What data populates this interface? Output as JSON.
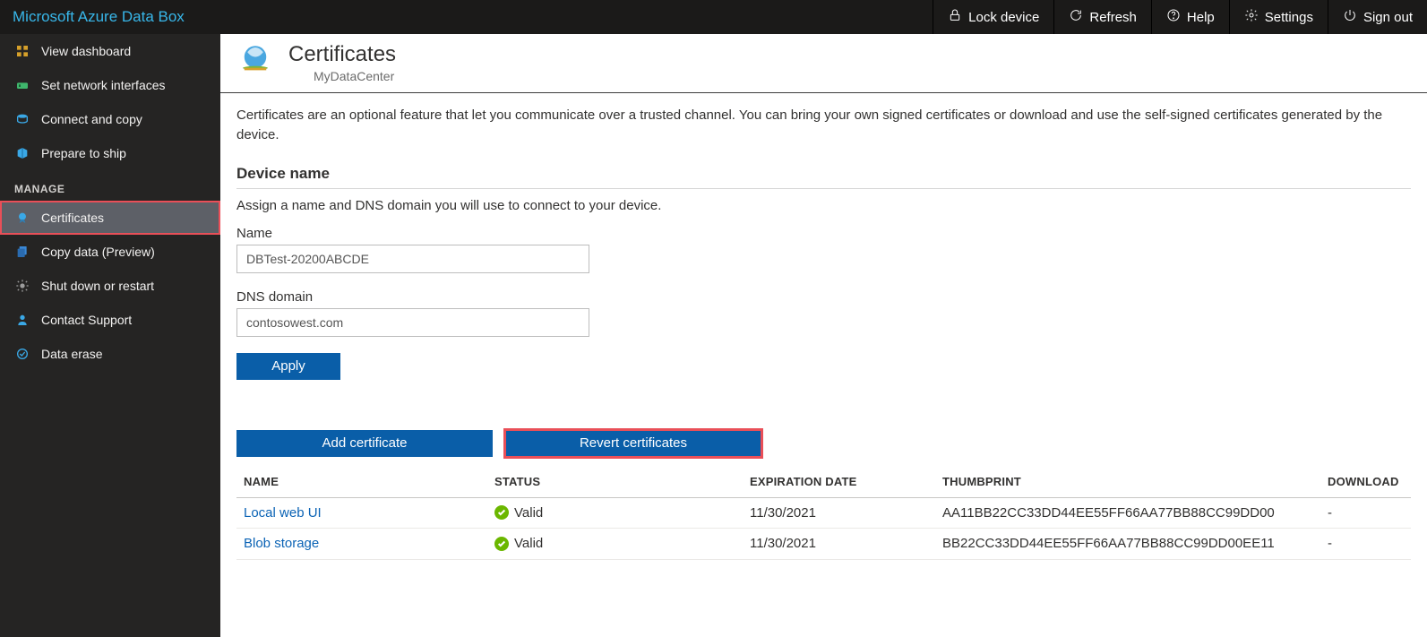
{
  "brand": "Microsoft Azure Data Box",
  "topbar": {
    "lock": "Lock device",
    "refresh": "Refresh",
    "help": "Help",
    "settings": "Settings",
    "signout": "Sign out"
  },
  "sidebar": {
    "items": [
      {
        "label": "View dashboard"
      },
      {
        "label": "Set network interfaces"
      },
      {
        "label": "Connect and copy"
      },
      {
        "label": "Prepare to ship"
      }
    ],
    "manage_head": "MANAGE",
    "manage": [
      {
        "label": "Certificates"
      },
      {
        "label": "Copy data (Preview)"
      },
      {
        "label": "Shut down or restart"
      },
      {
        "label": "Contact Support"
      },
      {
        "label": "Data erase"
      }
    ]
  },
  "page": {
    "title": "Certificates",
    "subtitle": "MyDataCenter",
    "description": "Certificates are an optional feature that let you communicate over a trusted channel. You can bring your own signed certificates or download and use the self-signed certificates generated by the device.",
    "device_name_h": "Device name",
    "device_name_sub": "Assign a name and DNS domain you will use to connect to your device.",
    "name_label": "Name",
    "name_value": "DBTest-20200ABCDE",
    "dns_label": "DNS domain",
    "dns_value": "contosowest.com",
    "apply": "Apply",
    "add_cert": "Add certificate",
    "revert_cert": "Revert certificates",
    "valid_label": "Valid",
    "table": {
      "cols": [
        "NAME",
        "STATUS",
        "EXPIRATION DATE",
        "THUMBPRINT",
        "DOWNLOAD"
      ],
      "rows": [
        {
          "name": "Local web UI",
          "status": "Valid",
          "exp": "11/30/2021",
          "thumb": "AA11BB22CC33DD44EE55FF66AA77BB88CC99DD00",
          "download": "-"
        },
        {
          "name": "Blob storage",
          "status": "Valid",
          "exp": "11/30/2021",
          "thumb": "BB22CC33DD44EE55FF66AA77BB88CC99DD00EE11",
          "download": "-"
        }
      ]
    }
  }
}
